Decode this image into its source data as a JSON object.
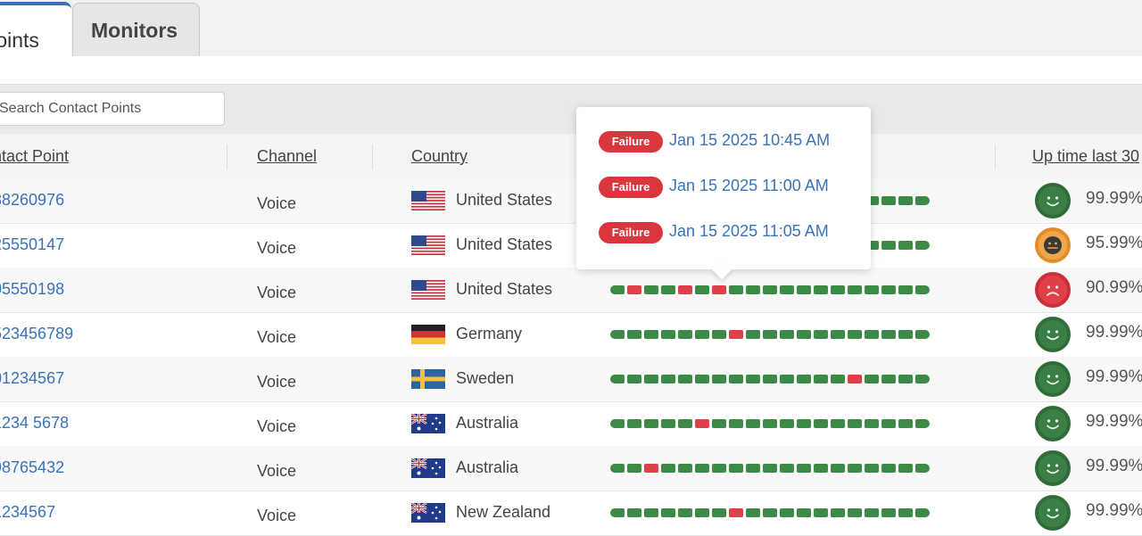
{
  "tabs": [
    {
      "label": "Points",
      "active": true
    },
    {
      "label": "Monitors",
      "active": false
    }
  ],
  "search": {
    "placeholder": "Search Contact Points"
  },
  "columns": {
    "contact_point": "ntact Point",
    "channel": "Channel",
    "country": "Country",
    "uptime": "Up time last 30"
  },
  "rows": [
    {
      "contact_point": "38260976",
      "channel": "Voice",
      "country": "United States",
      "flag": "us",
      "status": "good",
      "uptime": "99.99%",
      "failures": []
    },
    {
      "contact_point": "25550147",
      "channel": "Voice",
      "country": "United States",
      "flag": "us",
      "status": "warn",
      "uptime": "95.99%",
      "failures": []
    },
    {
      "contact_point": "05550198",
      "channel": "Voice",
      "country": "United States",
      "flag": "us",
      "status": "bad",
      "uptime": "90.99%",
      "failures": [
        1,
        4,
        6
      ]
    },
    {
      "contact_point": "523456789",
      "channel": "Voice",
      "country": "Germany",
      "flag": "de",
      "status": "good",
      "uptime": "99.99%",
      "failures": [
        7
      ]
    },
    {
      "contact_point": "01234567",
      "channel": "Voice",
      "country": "Sweden",
      "flag": "se",
      "status": "good",
      "uptime": "99.99%",
      "failures": [
        14
      ]
    },
    {
      "contact_point": "1234 5678",
      "channel": "Voice",
      "country": "Australia",
      "flag": "au",
      "status": "good",
      "uptime": "99.99%",
      "failures": [
        5
      ]
    },
    {
      "contact_point": "98765432",
      "channel": "Voice",
      "country": "Australia",
      "flag": "au",
      "status": "good",
      "uptime": "99.99%",
      "failures": [
        2
      ]
    },
    {
      "contact_point": "1234567",
      "channel": "Voice",
      "country": "New Zealand",
      "flag": "au",
      "status": "good",
      "uptime": "99.99%",
      "failures": [
        7
      ]
    }
  ],
  "tooltip": {
    "items": [
      {
        "badge": "Failure",
        "date": "Jan 15 2025 10:45 AM"
      },
      {
        "badge": "Failure",
        "date": "Jan 15 2025 11:00 AM"
      },
      {
        "badge": "Failure",
        "date": "Jan 15 2025 11:05 AM"
      }
    ]
  },
  "colors": {
    "accent": "#3b6fb5",
    "link": "#3a72b8",
    "success": "#3c8a46",
    "failure": "#e0404a",
    "warning": "#f0a64a"
  },
  "segments_per_bar": 19
}
